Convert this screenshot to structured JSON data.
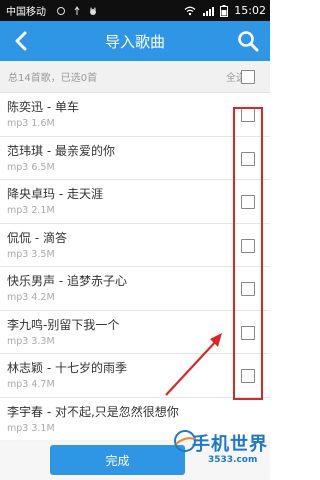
{
  "status_bar": {
    "carrier": "中国移动",
    "time": "15:02"
  },
  "header": {
    "title": "导入歌曲",
    "back_icon": "chevron-left-icon",
    "search_icon": "search-icon"
  },
  "summary": {
    "text": "总14首歌，已选0首",
    "select_all_label": "全选",
    "select_all_checked": false
  },
  "songs": [
    {
      "title": "陈奕迅 - 单车",
      "meta": "mp3 1.6M",
      "checked": false
    },
    {
      "title": "范玮琪 - 最亲爱的你",
      "meta": "mp3 6.5M",
      "checked": false
    },
    {
      "title": "降央卓玛 - 走天涯",
      "meta": "mp3 2.1M",
      "checked": false
    },
    {
      "title": "侃侃 - 滴答",
      "meta": "mp3 3.5M",
      "checked": false
    },
    {
      "title": "快乐男声 - 追梦赤子心",
      "meta": "mp3 4.2M",
      "checked": false
    },
    {
      "title": "李九鸣-别留下我一个",
      "meta": "mp3 3.3M",
      "checked": false
    },
    {
      "title": "林志颖 - 十七岁的雨季",
      "meta": "mp3 4.7M",
      "checked": false
    },
    {
      "title": "李宇春 - 对不起,只是忽然很想你",
      "meta": "mp3 3.1M",
      "checked": false
    }
  ],
  "bottom": {
    "done_label": "完成"
  },
  "watermark": {
    "name": "手机世界",
    "site": "3533.com"
  },
  "colors": {
    "accent": "#2f96e6",
    "annotation": "#e0252a"
  }
}
